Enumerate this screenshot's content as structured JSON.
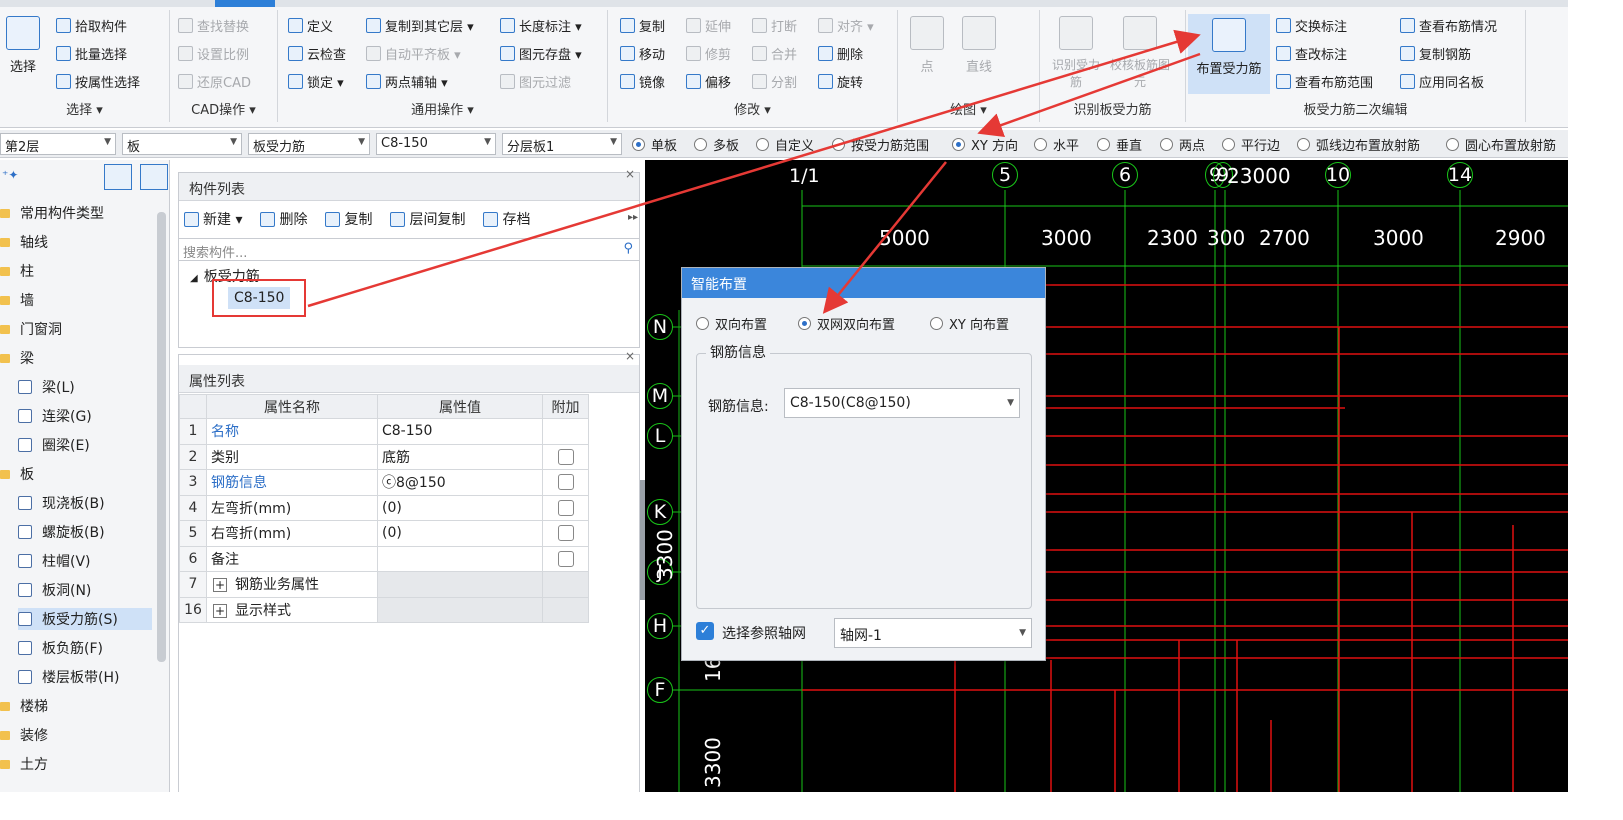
{
  "ribbon": {
    "select_group": {
      "big_button": "选择",
      "items": [
        "拾取构件",
        "批量选择",
        "按属性选择"
      ],
      "label": "选择 ▾"
    },
    "cad_group": {
      "items": [
        "查找替换",
        "设置比例",
        "还原CAD"
      ],
      "label": "CAD操作 ▾"
    },
    "general_group": {
      "col1": [
        "定义",
        "云检查",
        "锁定 ▾"
      ],
      "col2": [
        "复制到其它层 ▾",
        "自动平齐板 ▾",
        "两点辅轴 ▾"
      ],
      "col3": [
        "长度标注 ▾",
        "图元存盘 ▾",
        "图元过滤"
      ],
      "label": "通用操作 ▾"
    },
    "modify_group": {
      "col1": [
        "复制",
        "移动",
        "镜像"
      ],
      "col2": [
        "延伸",
        "修剪",
        "偏移"
      ],
      "col3": [
        "打断",
        "合并",
        "分割"
      ],
      "col4": [
        "对齐 ▾",
        "删除",
        "旋转"
      ],
      "label": "修改 ▾"
    },
    "draw_group": {
      "items": [
        "点",
        "直线"
      ],
      "label": "绘图 ▾"
    },
    "identify_group": {
      "items": [
        "识别受力筋",
        "校核板筋图元"
      ],
      "label": "识别板受力筋"
    },
    "edit_group": {
      "big_button": "布置受力筋",
      "col1": [
        "交换标注",
        "查改标注",
        "查看布筋范围"
      ],
      "col2": [
        "查看布筋情况",
        "复制钢筋",
        "应用同名板"
      ],
      "label": "板受力筋二次编辑"
    }
  },
  "toolbar": {
    "combos": [
      "第2层",
      "板",
      "板受力筋",
      "C8-150",
      "分层板1"
    ],
    "radios": [
      "单板",
      "多板",
      "自定义",
      "按受力筋范围",
      "XY 方向",
      "水平",
      "垂直",
      "两点",
      "平行边",
      "弧线边布置放射筋",
      "圆心布置放射筋"
    ],
    "selected_radio": "XY 方向"
  },
  "tree": {
    "items": [
      {
        "label": "常用构件类型",
        "type": "folder"
      },
      {
        "label": "轴线",
        "type": "folder"
      },
      {
        "label": "柱",
        "type": "folder"
      },
      {
        "label": "墙",
        "type": "folder"
      },
      {
        "label": "门窗洞",
        "type": "folder"
      },
      {
        "label": "梁",
        "type": "folder"
      },
      {
        "label": "梁(L)",
        "type": "leaf"
      },
      {
        "label": "连梁(G)",
        "type": "leaf"
      },
      {
        "label": "圈梁(E)",
        "type": "leaf"
      },
      {
        "label": "板",
        "type": "folder"
      },
      {
        "label": "现浇板(B)",
        "type": "leaf"
      },
      {
        "label": "螺旋板(B)",
        "type": "leaf"
      },
      {
        "label": "柱帽(V)",
        "type": "leaf"
      },
      {
        "label": "板洞(N)",
        "type": "leaf"
      },
      {
        "label": "板受力筋(S)",
        "type": "leaf"
      },
      {
        "label": "板负筋(F)",
        "type": "leaf"
      },
      {
        "label": "楼层板带(H)",
        "type": "leaf"
      },
      {
        "label": "楼梯",
        "type": "folder"
      },
      {
        "label": "装修",
        "type": "folder"
      },
      {
        "label": "土方",
        "type": "folder"
      }
    ],
    "selected": "板受力筋(S)"
  },
  "component_panel": {
    "title": "构件列表",
    "actions": [
      "新建 ▾",
      "删除",
      "复制",
      "层间复制",
      "存档"
    ],
    "search_placeholder": "搜索构件...",
    "group": "板受力筋",
    "item": "C8-150"
  },
  "property_panel": {
    "title": "属性列表",
    "headers": [
      "属性名称",
      "属性值",
      "附加"
    ],
    "rows": [
      {
        "no": "1",
        "name": "名称",
        "value": "C8-150",
        "blue": true,
        "check": false
      },
      {
        "no": "2",
        "name": "类别",
        "value": "底筋",
        "blue": false,
        "check": true
      },
      {
        "no": "3",
        "name": "钢筋信息",
        "value": "ⓒ8@150",
        "blue": true,
        "check": true
      },
      {
        "no": "4",
        "name": "左弯折(mm)",
        "value": "(0)",
        "blue": false,
        "check": true
      },
      {
        "no": "5",
        "name": "右弯折(mm)",
        "value": "(0)",
        "blue": false,
        "check": true
      },
      {
        "no": "6",
        "name": "备注",
        "value": "",
        "blue": false,
        "check": true
      },
      {
        "no": "7",
        "name": "钢筋业务属性",
        "value": "",
        "blue": false,
        "check": false,
        "expand": true
      },
      {
        "no": "16",
        "name": "显示样式",
        "value": "",
        "blue": false,
        "check": false,
        "expand": true
      }
    ]
  },
  "canvas": {
    "top_axes": [
      "1/1",
      "5",
      "6",
      "9",
      "9",
      "10",
      "14"
    ],
    "top_dims": [
      "5000",
      "3000",
      "2300",
      "300",
      "2700",
      "3000",
      "2900",
      "23000"
    ],
    "left_axes": [
      "N",
      "M",
      "L",
      "K",
      "J",
      "H",
      "F"
    ],
    "left_dims": [
      "3300",
      "16",
      "3300"
    ]
  },
  "dialog": {
    "title": "智能布置",
    "options": [
      "双向布置",
      "双网双向布置",
      "XY 向布置"
    ],
    "selected": "双网双向布置",
    "fieldset_label": "钢筋信息",
    "field_label": "钢筋信息:",
    "field_value": "C8-150(C8@150)",
    "ref_axis_label": "选择参照轴网",
    "ref_axis_value": "轴网-1"
  },
  "colors": {
    "accent": "#2d7fd8",
    "annotation": "#e53935",
    "grid_green": "#19c519",
    "slab_red": "#e01010"
  }
}
